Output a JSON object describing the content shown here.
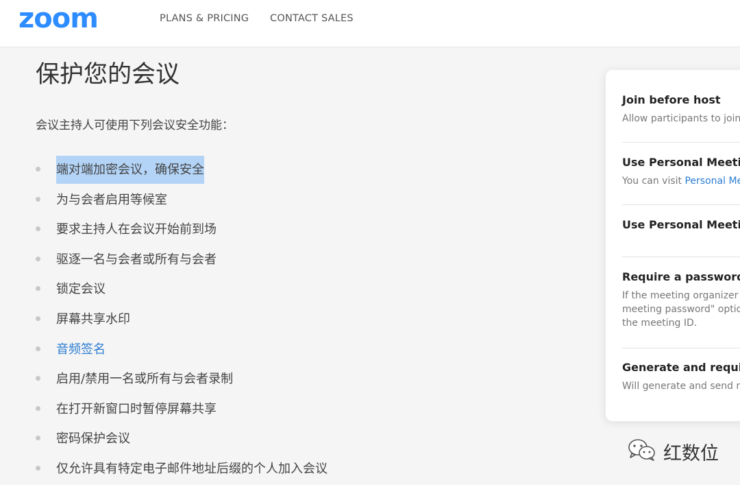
{
  "header": {
    "logo": "zoom",
    "nav": {
      "plans": "PLANS & PRICING",
      "contact": "CONTACT SALES"
    }
  },
  "main": {
    "title": "保护您的会议",
    "intro": "会议主持人可使用下列会议安全功能：",
    "features": [
      "端对端加密会议，确保安全",
      "为与会者启用等候室",
      "要求主持人在会议开始前到场",
      "驱逐一名与会者或所有与会者",
      "锁定会议",
      "屏幕共享水印",
      "音频签名",
      "启用/禁用一名或所有与会者录制",
      "在打开新窗口时暂停屏幕共享",
      "密码保护会议",
      "仅允许具有特定电子邮件地址后缀的个人加入会议"
    ]
  },
  "settings": {
    "join_before_host": {
      "title": "Join before host",
      "desc": "Allow participants to join"
    },
    "use_pmi_1": {
      "title": "Use Personal Meeting",
      "desc_prefix": "You can visit ",
      "desc_link": "Personal Me"
    },
    "use_pmi_2": {
      "title": "Use Personal Meeting"
    },
    "require_password": {
      "title": "Require a password fo",
      "desc_1": "If the meeting organizer s",
      "desc_2": "meeting password\" optio",
      "desc_3": "the meeting ID."
    },
    "generate_password": {
      "title": "Generate and require p",
      "desc": "Will generate and send n"
    }
  },
  "watermark": {
    "text": "红数位",
    "icon": "wechat-icon"
  }
}
